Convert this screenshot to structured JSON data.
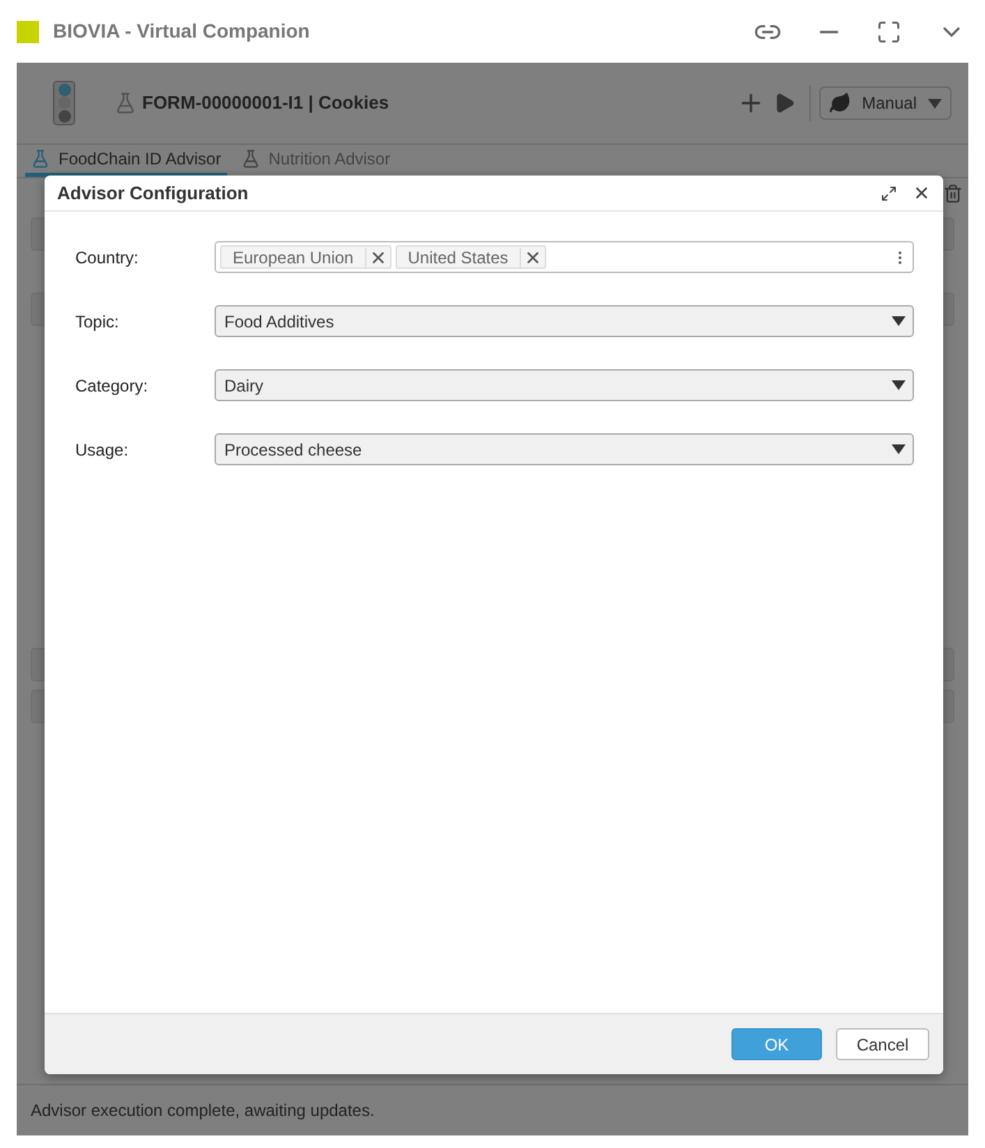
{
  "window": {
    "title": "BIOVIA - Virtual Companion"
  },
  "header": {
    "title": "FORM-00000001-I1 | Cookies",
    "mode": "Manual"
  },
  "tabs": [
    {
      "label": "FoodChain ID Advisor",
      "selected": true
    },
    {
      "label": "Nutrition Advisor",
      "selected": false
    }
  ],
  "dialog": {
    "title": "Advisor Configuration",
    "fields": [
      {
        "kind": "tags",
        "label": "Country:",
        "tags": [
          "European Union",
          "United States"
        ]
      },
      {
        "kind": "select",
        "label": "Topic:",
        "value": "Food Additives"
      },
      {
        "kind": "select",
        "label": "Category:",
        "value": "Dairy"
      },
      {
        "kind": "select",
        "label": "Usage:",
        "value": "Processed cheese"
      }
    ],
    "buttons": [
      {
        "label": "OK",
        "primary": true
      },
      {
        "label": "Cancel",
        "primary": false
      }
    ]
  },
  "status_bar": "Advisor execution complete, awaiting updates."
}
